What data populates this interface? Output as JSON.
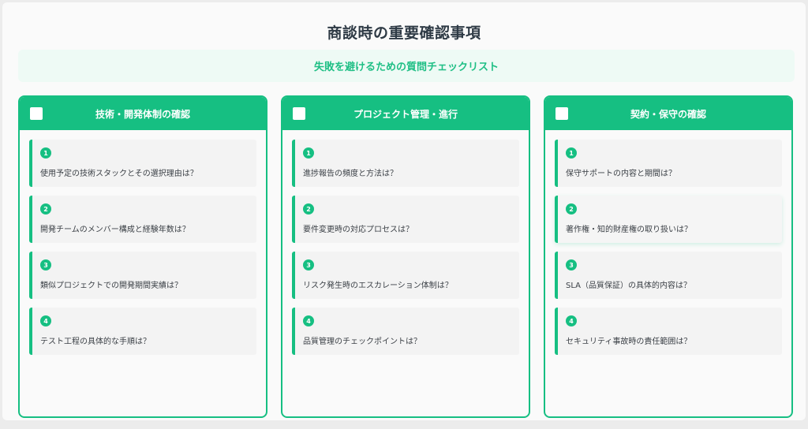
{
  "title": "商談時の重要確認事項",
  "subtitle": "失敗を避けるための質問チェックリスト",
  "colors": {
    "accent": "#16bf82",
    "subtitle_bg": "#eefaf5",
    "title": "#2e3a45"
  },
  "cards": [
    {
      "header": "技術・開発体制の確認",
      "items": [
        {
          "num": "1",
          "text": "使用予定の技術スタックとその選択理由は？"
        },
        {
          "num": "2",
          "text": "開発チームのメンバー構成と経験年数は？"
        },
        {
          "num": "3",
          "text": "類似プロジェクトでの開発期間実績は？"
        },
        {
          "num": "4",
          "text": "テスト工程の具体的な手順は？"
        }
      ]
    },
    {
      "header": "プロジェクト管理・進行",
      "items": [
        {
          "num": "1",
          "text": "進捗報告の頻度と方法は？"
        },
        {
          "num": "2",
          "text": "要件変更時の対応プロセスは？"
        },
        {
          "num": "3",
          "text": "リスク発生時のエスカレーション体制は？"
        },
        {
          "num": "4",
          "text": "品質管理のチェックポイントは？"
        }
      ]
    },
    {
      "header": "契約・保守の確認",
      "items": [
        {
          "num": "1",
          "text": "保守サポートの内容と期間は？"
        },
        {
          "num": "2",
          "text": "著作権・知的財産権の取り扱いは？"
        },
        {
          "num": "3",
          "text": "SLA（品質保証）の具体的内容は？"
        },
        {
          "num": "4",
          "text": "セキュリティ事故時の責任範囲は？"
        }
      ]
    }
  ]
}
